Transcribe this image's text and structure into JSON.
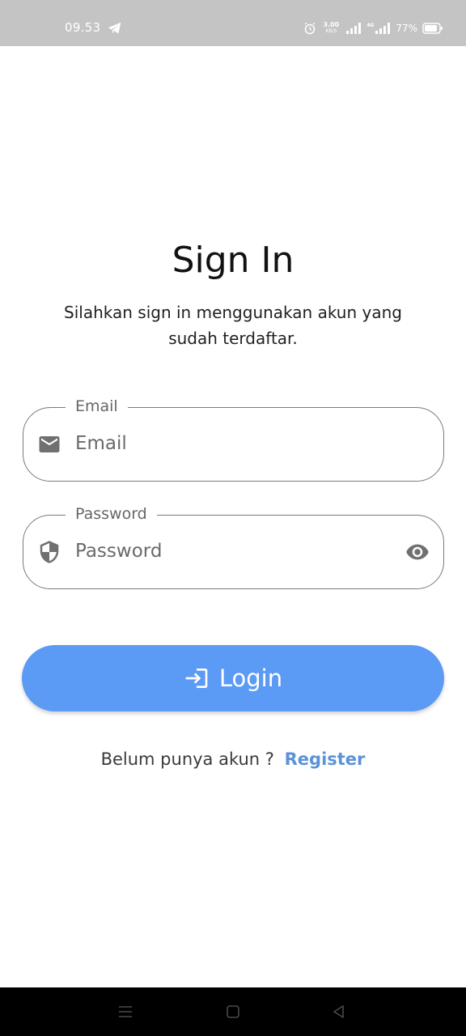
{
  "status_bar": {
    "time": "09.53",
    "speed_value": "3.00",
    "speed_unit": "KB/S",
    "network": "4G",
    "battery": "77%",
    "icons": [
      "telegram-icon",
      "alarm-icon",
      "signal-icon",
      "battery-icon"
    ]
  },
  "header": {
    "title": "Sign In",
    "subtitle": "Silahkan sign in menggunakan akun yang sudah terdaftar."
  },
  "form": {
    "email": {
      "label": "Email",
      "placeholder": "Email",
      "value": "",
      "icon": "email-icon"
    },
    "password": {
      "label": "Password",
      "placeholder": "Password",
      "value": "",
      "icon": "shield-icon",
      "toggle_icon": "eye-icon"
    },
    "login_button": {
      "label": "Login",
      "icon": "login-icon",
      "color": "#5b9af5"
    }
  },
  "footer": {
    "prompt": "Belum punya akun ?",
    "register_label": "Register",
    "register_color": "#5b93d6"
  },
  "nav_bar": {
    "icons": [
      "menu-icon",
      "home-icon",
      "back-icon"
    ]
  }
}
